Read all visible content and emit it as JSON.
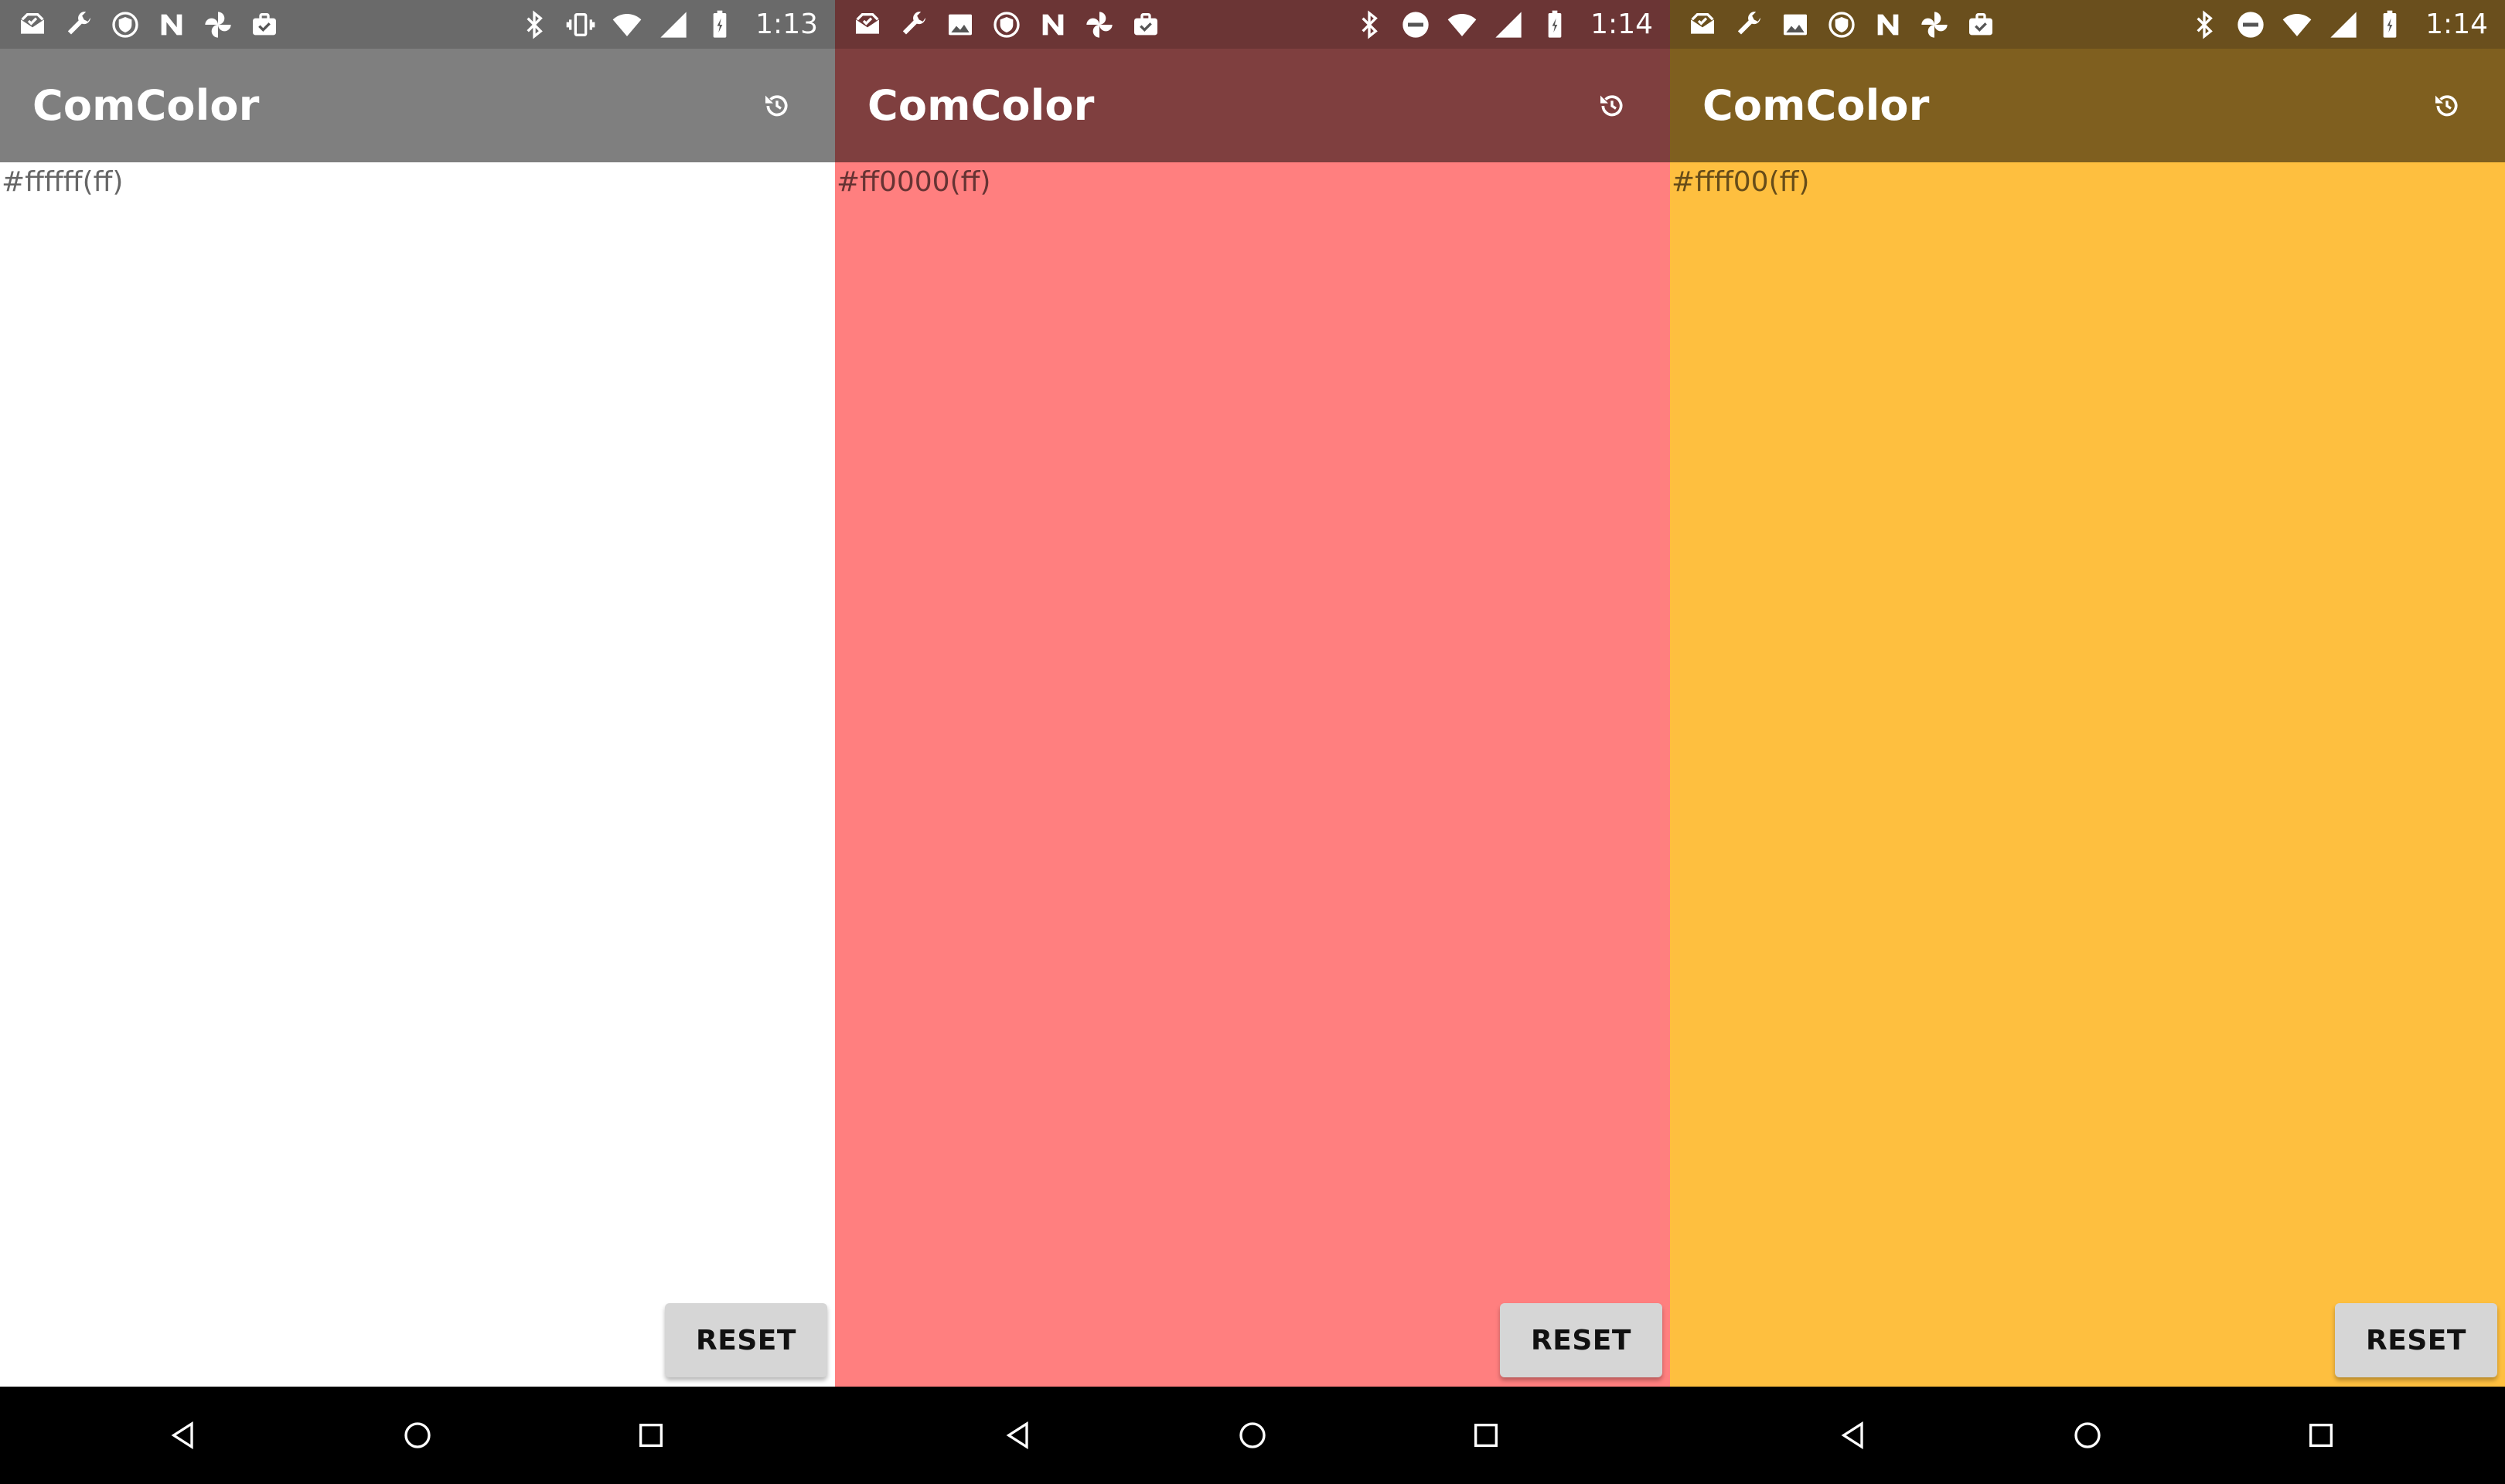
{
  "screens": [
    {
      "time": "1:13",
      "title": "ComColor",
      "hex_text": "#ffffff(ff)",
      "reset_label": "RESET",
      "colors": {
        "status_bar": "#6a6a6a",
        "app_bar": "#7f7f7f",
        "background": "#ffffff"
      },
      "status_left_icons": [
        "mail-icon",
        "wrench-icon",
        "shield-icon",
        "n-icon",
        "pinwheel-icon",
        "briefcase-check-icon"
      ],
      "status_right_icons": [
        "bluetooth-icon",
        "vibrate-icon",
        "wifi-icon",
        "signal-icon",
        "battery-icon"
      ]
    },
    {
      "time": "1:14",
      "title": "ComColor",
      "hex_text": "#ff0000(ff)",
      "reset_label": "RESET",
      "colors": {
        "status_bar": "#6b3535",
        "app_bar": "#7f3f3f",
        "background": "#ff7f7f"
      },
      "status_left_icons": [
        "mail-icon",
        "wrench-icon",
        "image-icon",
        "shield-icon",
        "n-icon",
        "pinwheel-icon",
        "briefcase-check-icon"
      ],
      "status_right_icons": [
        "bluetooth-icon",
        "dnd-icon",
        "wifi-icon",
        "signal-icon",
        "battery-icon"
      ]
    },
    {
      "time": "1:14",
      "title": "ComColor",
      "hex_text": "#ffff00(ff)",
      "reset_label": "RESET",
      "colors": {
        "status_bar": "#6a4f1d",
        "app_bar": "#7f5f1f",
        "background": "#febf3f"
      },
      "status_left_icons": [
        "mail-icon",
        "wrench-icon",
        "image-icon",
        "shield-icon",
        "n-icon",
        "pinwheel-icon",
        "briefcase-check-icon"
      ],
      "status_right_icons": [
        "bluetooth-icon",
        "dnd-icon",
        "wifi-icon",
        "signal-icon",
        "battery-icon"
      ]
    }
  ],
  "navigation": {
    "icons": [
      "back-icon",
      "home-icon",
      "recents-icon"
    ]
  }
}
